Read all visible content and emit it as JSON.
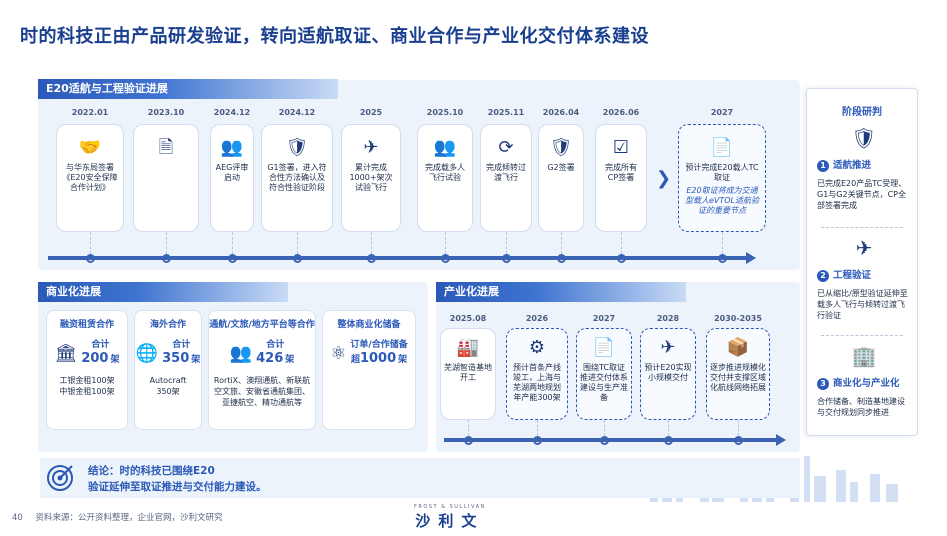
{
  "title": "时的科技正由产品研发验证，转向适航取证、商业合作与产业化交付体系建设",
  "section_airworthiness": {
    "header": "E20适航与工程验证进展",
    "items": [
      {
        "date": "2022.01",
        "icon": "handshake-icon",
        "text": "与华东局签署《E20安全保障合作计划》"
      },
      {
        "date": "2023.10",
        "icon": "document-icon",
        "text": ""
      },
      {
        "date": "2024.12",
        "icon": "team-icon",
        "text": "AEG评审启动"
      },
      {
        "date": "2024.12",
        "icon": "shield-check-icon",
        "text": "G1签署，进入符合性方法确认及符合性验证阶段"
      },
      {
        "date": "2025",
        "icon": "drone-icon",
        "text": "累计完成1000+架次试验飞行"
      },
      {
        "date": "2025.10",
        "icon": "team-icon",
        "text": "完成载多人飞行试验"
      },
      {
        "date": "2025.11",
        "icon": "cycle-icon",
        "text": "完成倾转过渡飞行"
      },
      {
        "date": "2026.04",
        "icon": "shield-check-icon",
        "text": "G2签署"
      },
      {
        "date": "2026.06",
        "icon": "checklist-icon",
        "text": "完成所有CP签署"
      },
      {
        "date": "2027",
        "icon": "certificate-icon",
        "text": "预计完成E20载人TC取证",
        "note": "E20取证将成为交通型载人eVTOL适航验证的重要节点"
      }
    ]
  },
  "section_commercial": {
    "header": "商业化进展",
    "boxes": [
      {
        "title": "融资租赁合作",
        "label": "合计",
        "value": "200",
        "unit": "架",
        "icon": "bank-icon",
        "detail": "工银金租100架\n中银金租100架"
      },
      {
        "title": "海外合作",
        "label": "合计",
        "value": "350",
        "unit": "架",
        "icon": "globe-icon",
        "detail": "Autocraft\n350架"
      },
      {
        "title": "通航/文旅/地方平台等合作",
        "label": "合计",
        "value": "426",
        "unit": "架",
        "icon": "team-icon",
        "detail": "RortiX、澳翔通航、新联航空文旅、安徽省通航集团、亚捷航空、精功通航等"
      },
      {
        "title": "整体商业化储备",
        "label": "订单/合作储备",
        "value_prefix": "超",
        "value": "1000",
        "unit": "架",
        "icon": "network-icon",
        "detail": ""
      }
    ]
  },
  "section_industrial": {
    "header": "产业化进展",
    "items": [
      {
        "date": "2025.08",
        "icon": "factory-icon",
        "text": "芜湖智造基地开工"
      },
      {
        "date": "2026",
        "icon": "assembly-icon",
        "text": "预计首条产线竣工，上海与芜湖两地规划年产能300架"
      },
      {
        "date": "2027",
        "icon": "certificate-icon",
        "text": "围绕TC取证推进交付体系建设与生产准备"
      },
      {
        "date": "2028",
        "icon": "drone-icon",
        "text": "预计E20实现小规模交付"
      },
      {
        "date": "2030-2035",
        "icon": "box-icon",
        "text": "逐步推进规模化交付并支撑区域化航线网络拓展"
      }
    ]
  },
  "stage_panel": {
    "title": "阶段研判",
    "stages": [
      {
        "num": "1",
        "head": "适航推进",
        "icon": "shield-check-icon",
        "text": "已完成E20产品TC受理、G1与G2关键节点，CP全部签署完成"
      },
      {
        "num": "2",
        "head": "工程验证",
        "icon": "drone-icon",
        "text": "已从缩比/原型验证延伸至载多人飞行与倾转过渡飞行验证"
      },
      {
        "num": "3",
        "head": "商业化与产业化",
        "icon": "buildings-icon",
        "text": "合作储备、制造基地建设与交付规划同步推进"
      }
    ]
  },
  "conclusion": {
    "line1": "结论：时的科技已围绕E20",
    "line2": "验证延伸至取证推进与交付能力建设。"
  },
  "footer": {
    "page": "40",
    "source": "资料来源：公开资料整理，企业官网，沙利文研究",
    "brand_en": "FROST & SULLIVAN",
    "brand_cn": "沙利文"
  }
}
